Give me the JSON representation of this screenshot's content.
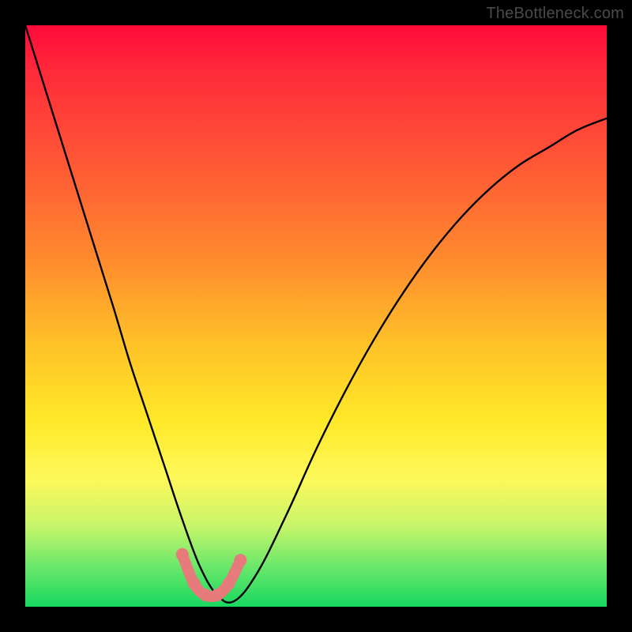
{
  "attribution": "TheBottleneck.com",
  "chart_data": {
    "type": "line",
    "title": "",
    "xlabel": "",
    "ylabel": "",
    "xlim": [
      0,
      100
    ],
    "ylim": [
      0,
      100
    ],
    "grid": false,
    "legend": null,
    "series": [
      {
        "name": "bottleneck-curve",
        "x": [
          0,
          5,
          10,
          15,
          18,
          21,
          24,
          27,
          30,
          33,
          36,
          40,
          45,
          50,
          55,
          60,
          65,
          70,
          75,
          80,
          85,
          90,
          95,
          100
        ],
        "values": [
          100,
          84,
          68,
          52,
          42,
          33,
          24,
          15,
          7,
          2,
          1,
          6,
          16,
          27,
          37,
          46,
          54,
          61,
          67,
          72,
          76,
          79,
          82,
          84
        ]
      }
    ],
    "markers": {
      "name": "highlighted-low-bottleneck",
      "x": [
        27,
        29,
        31,
        33,
        35,
        37
      ],
      "values": [
        9,
        4,
        2,
        2,
        4,
        8
      ]
    },
    "gradient_meaning": "y-axis value encodes color: 100=red (high bottleneck), 0=green (no bottleneck)"
  }
}
